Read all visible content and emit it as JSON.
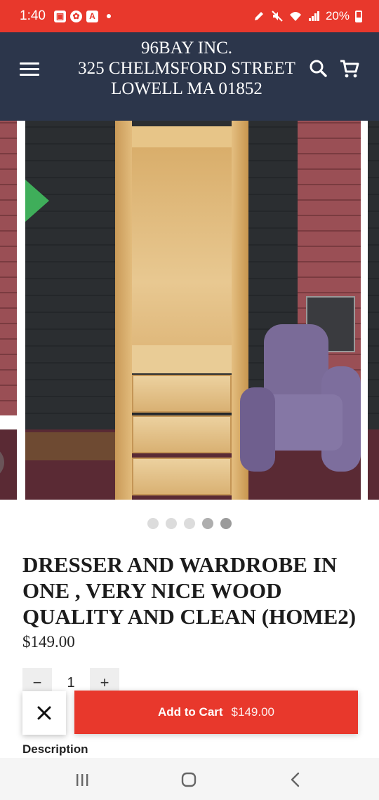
{
  "status_bar": {
    "time": "1:40",
    "battery": "20%",
    "notif_icons": [
      "image-icon",
      "app-icon",
      "a-icon"
    ]
  },
  "header": {
    "store_name_lines": [
      "96BAY INC.",
      "325 CHELMSFORD STREET",
      "LOWELL MA 01852"
    ],
    "icons": [
      "menu-icon",
      "search-icon",
      "cart-icon"
    ],
    "background_color": "#2c364b"
  },
  "gallery": {
    "image_count": 5,
    "active_index": 4
  },
  "product": {
    "title": "DRESSER AND WARDROBE IN ONE , VERY NICE WOOD QUALITY AND CLEAN (HOME2)",
    "price": "$149.00",
    "quantity": "1",
    "minus_label": "−",
    "plus_label": "+"
  },
  "cart_bar": {
    "add_label": "Add to Cart",
    "price": "$149.00",
    "accent_color": "#e8382c"
  },
  "description_label": "Description",
  "nav": {
    "icons": [
      "recent-apps-icon",
      "home-icon",
      "back-icon"
    ]
  }
}
